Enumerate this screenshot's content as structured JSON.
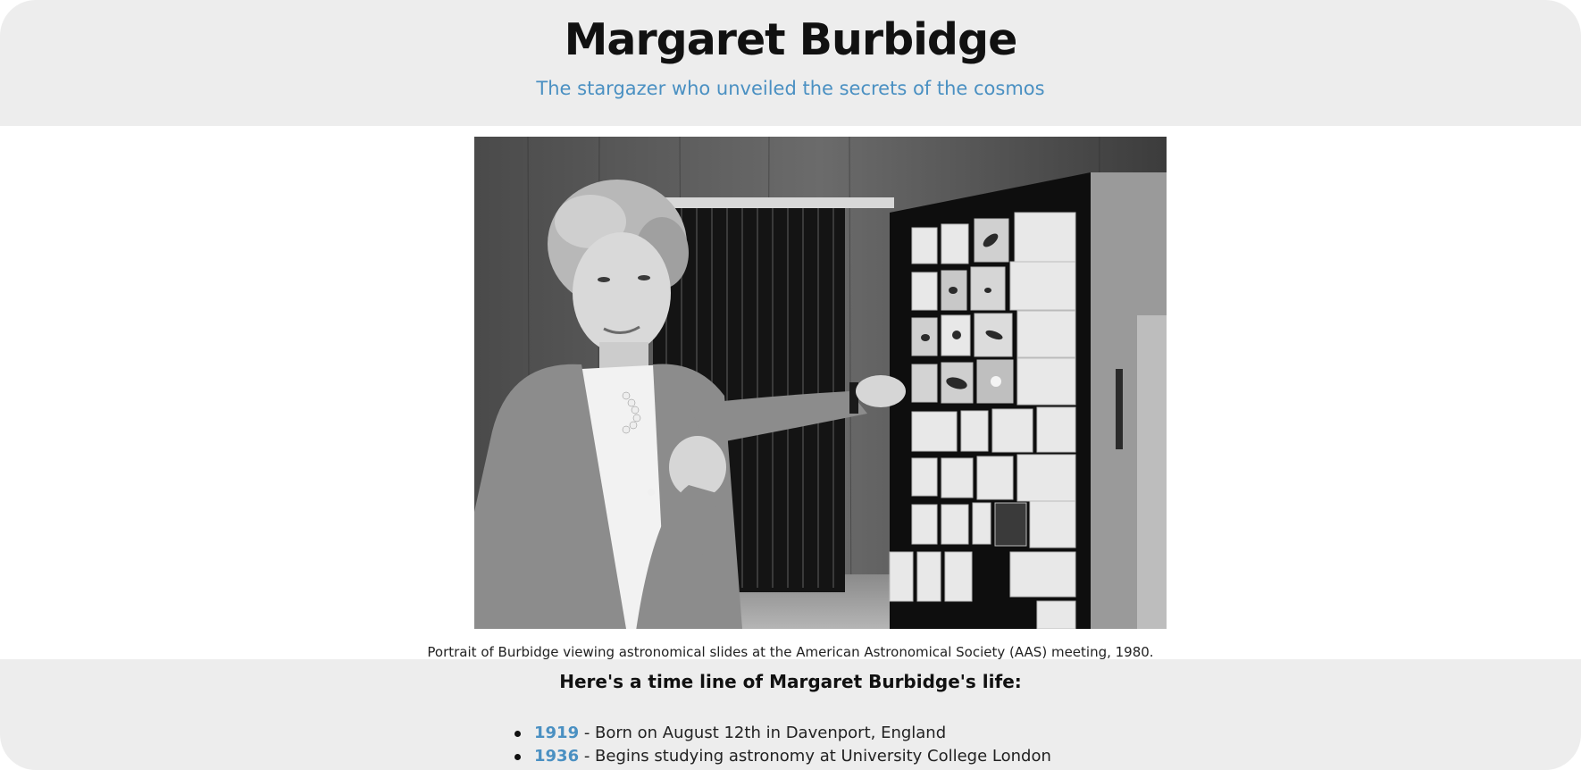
{
  "header": {
    "title": "Margaret Burbidge",
    "subtitle": "The stargazer who unveiled the secrets of the cosmos"
  },
  "figure": {
    "image_description": "Black-and-white photo of a woman pointing at a cabinet of astronomical slides",
    "caption": "Portrait of Burbidge viewing astronomical slides at the American Astronomical Society (AAS) meeting, 1980."
  },
  "timeline": {
    "heading": "Here's a time line of Margaret Burbidge's life:",
    "items": [
      {
        "year": "1919",
        "text": " - Born on August 12th in Davenport, England"
      },
      {
        "year": "1936",
        "text": " - Begins studying astronomy at University College London"
      }
    ]
  },
  "colors": {
    "accent": "#4a90c2",
    "band_background": "#ededed"
  }
}
